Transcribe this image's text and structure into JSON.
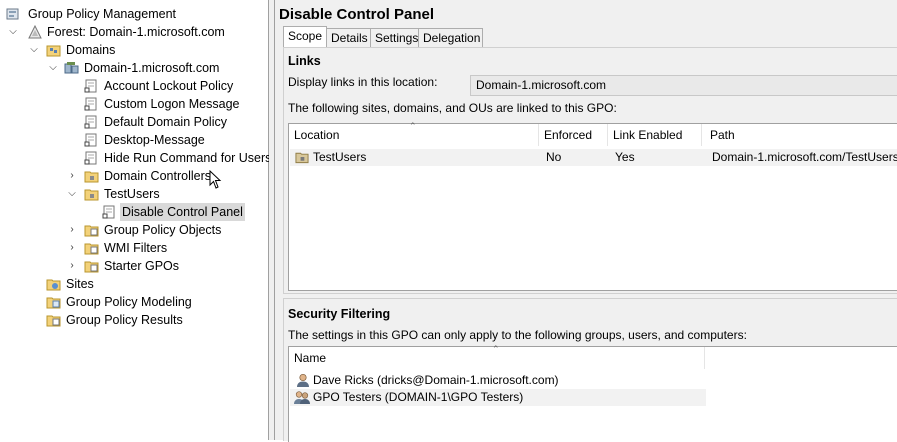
{
  "tree": {
    "root": "Group Policy Management",
    "forest": "Forest: Domain-1.microsoft.com",
    "domains": "Domains",
    "domain": "Domain-1.microsoft.com",
    "gpo_links": [
      "Account Lockout Policy",
      "Custom Logon Message",
      "Default Domain Policy",
      "Desktop-Message",
      "Hide Run Command for Users"
    ],
    "domain_controllers": "Domain Controllers",
    "test_users": "TestUsers",
    "selected_gpo": "Disable Control Panel",
    "gpo_objects": "Group Policy Objects",
    "wmi_filters": "WMI Filters",
    "starter_gpos": "Starter GPOs",
    "sites": "Sites",
    "modeling": "Group Policy Modeling",
    "results": "Group Policy Results"
  },
  "content": {
    "title": "Disable Control Panel",
    "tabs": [
      "Scope",
      "Details",
      "Settings",
      "Delegation"
    ],
    "links": {
      "section_title": "Links",
      "display_label": "Display links in this location:",
      "display_value": "Domain-1.microsoft.com",
      "description": "The following sites, domains, and OUs are linked to this GPO:",
      "columns": [
        "Location",
        "Enforced",
        "Link Enabled",
        "Path"
      ],
      "rows": [
        {
          "location": "TestUsers",
          "enforced": "No",
          "link_enabled": "Yes",
          "path": "Domain-1.microsoft.com/TestUsers"
        }
      ]
    },
    "security": {
      "section_title": "Security Filtering",
      "description": "The settings in this GPO can only apply to the following groups, users, and computers:",
      "column": "Name",
      "rows": [
        "Dave Ricks (dricks@Domain-1.microsoft.com)",
        "GPO Testers (DOMAIN-1\\GPO Testers)"
      ]
    }
  }
}
